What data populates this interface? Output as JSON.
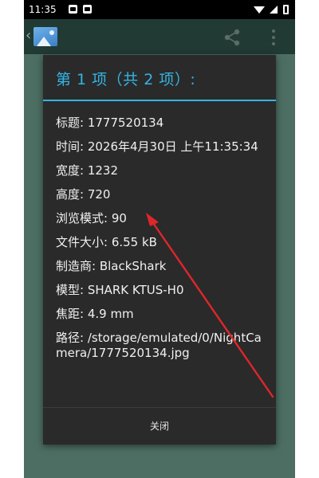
{
  "status_bar": {
    "time": "11:35"
  },
  "dialog": {
    "title": "第 1 项（共 2 项）:",
    "details": [
      "标题: 1777520134",
      "时间: 2026年4月30日 上午11:35:34",
      "宽度: 1232",
      "高度: 720",
      "浏览模式: 90",
      "文件大小: 6.55 kB",
      "制造商: BlackShark",
      "模型: SHARK KTUS-H0",
      "焦距: 4.9 mm",
      "路径: /storage/emulated/0/NightCamera/1777520134.jpg"
    ],
    "close_label": "关闭"
  },
  "colors": {
    "accent": "#33b5e5",
    "dialog_bg": "#2a2a2a",
    "app_background": "#4d6e62",
    "app_bar": "#213a33",
    "annotation_arrow": "#e0262b"
  },
  "icons": [
    "gallery-app-icon",
    "share-icon",
    "more-options-icon",
    "back-chevron-icon",
    "wifi-icon",
    "signal-icon",
    "battery-icon"
  ]
}
